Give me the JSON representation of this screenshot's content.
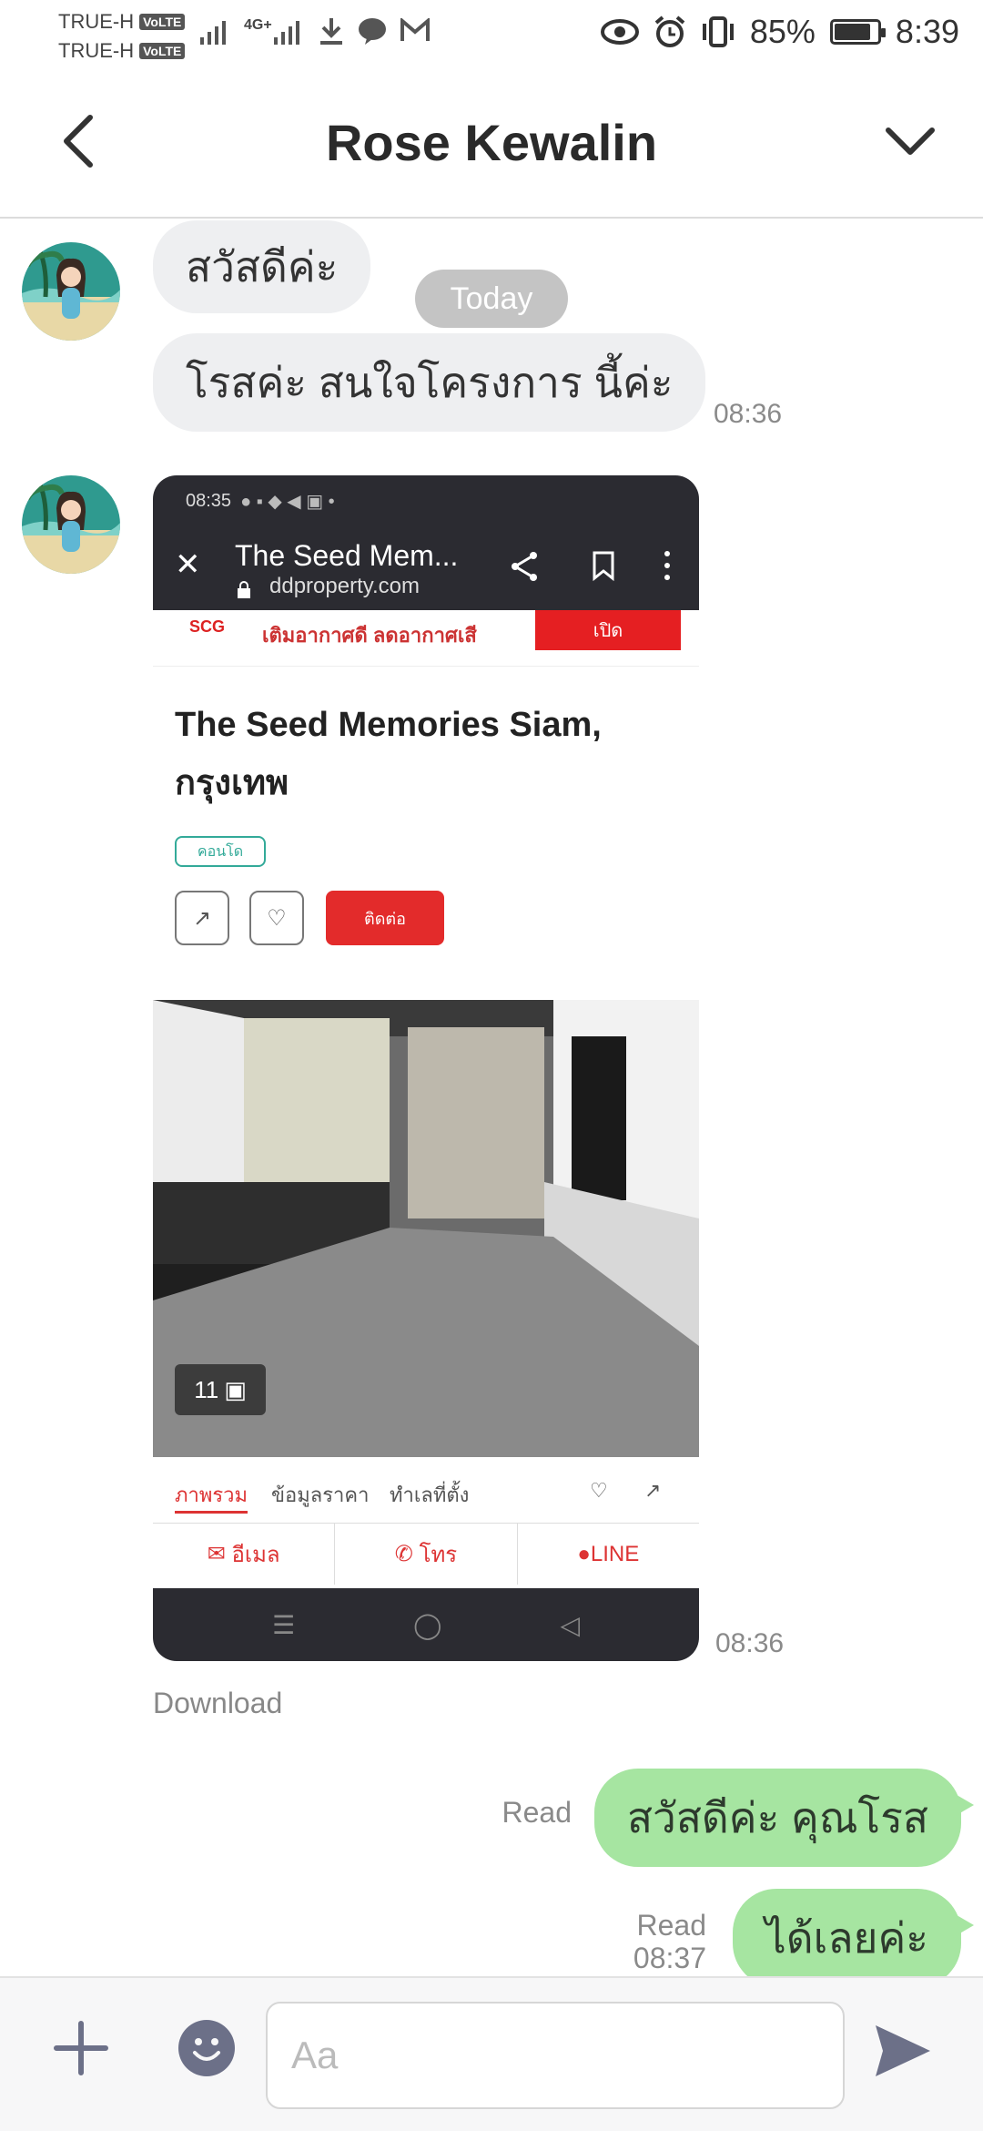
{
  "status_bar": {
    "carrier_1": "TRUE-H",
    "carrier_2": "TRUE-H",
    "volte": "VoLTE",
    "network": "4G+",
    "battery_percent": "85%",
    "battery_level": 0.85,
    "time": "8:39"
  },
  "header": {
    "title": "Rose Kewalin"
  },
  "chat": {
    "date_divider": "Today",
    "messages_in": [
      {
        "text": "สวัสดีค่ะ"
      },
      {
        "text": "โรสค่ะ สนใจโครงการ นี้ค่ะ",
        "time": "08:36"
      }
    ],
    "image_message": {
      "time": "08:36",
      "download_label": "Download",
      "screenshot": {
        "status_time": "08:35",
        "page_title": "The Seed Mem...",
        "page_url": "ddproperty.com",
        "ad_brand": "SCG",
        "ad_text": "เติมอากาศดี ลดอากาศเสี",
        "ad_button": "เปิด",
        "listing_title": "The Seed Memories Siam, กรุงเทพ",
        "tag": "คอนโด",
        "contact_button": "ติดต่อ",
        "photo_count": "11",
        "tabs": [
          "ภาพรวม",
          "ข้อมูลราคา",
          "ทำเลที่ตั้ง"
        ],
        "actions": [
          "อีเมล",
          "โทร",
          "LINE"
        ]
      }
    },
    "messages_out": [
      {
        "text": "สวัสดีค่ะ คุณโรส",
        "status": "Read"
      },
      {
        "text": "ได้เลยค่ะ",
        "status": "Read",
        "time": "08:37"
      }
    ]
  },
  "composer": {
    "placeholder": "Aa"
  },
  "colors": {
    "incoming_bubble": "#eeeff1",
    "outgoing_bubble": "#a6e5a1",
    "accent": "#6c7088"
  }
}
